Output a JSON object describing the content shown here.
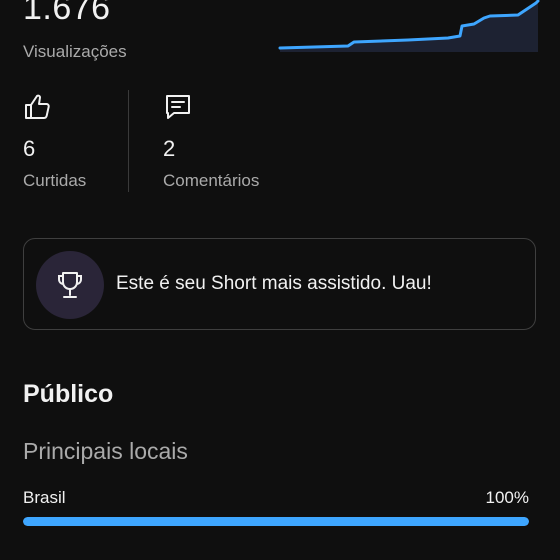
{
  "summary": {
    "views_value": "1.676",
    "views_label": "Visualizações",
    "trend_accent": "#3ea6ff"
  },
  "stats": {
    "likes": {
      "icon": "thumb-up-icon",
      "value": "6",
      "label": "Curtidas"
    },
    "comments": {
      "icon": "comment-icon",
      "value": "2",
      "label": "Comentários"
    }
  },
  "achievement": {
    "icon": "trophy-icon",
    "text": "Este é seu Short mais assistido. Uau!"
  },
  "audience": {
    "title": "Público",
    "top_locations_title": "Principais locais",
    "locations": [
      {
        "name": "Brasil",
        "percent_label": "100%",
        "percent": 100
      }
    ]
  }
}
